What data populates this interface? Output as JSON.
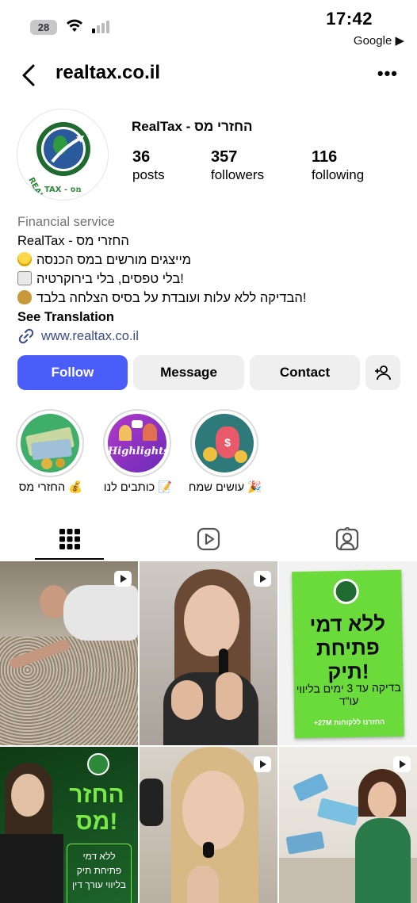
{
  "status_bar": {
    "battery": "28",
    "time": "17:42",
    "back_app": "Google ▶"
  },
  "header": {
    "username": "realtax.co.il",
    "more": "•••"
  },
  "profile": {
    "display_name": "RealTax - החזרי מס",
    "stats": [
      {
        "value": "36",
        "label": "posts"
      },
      {
        "value": "357",
        "label": "followers"
      },
      {
        "value": "116",
        "label": "following"
      }
    ],
    "category": "Financial service",
    "bio_lines": [
      "RealTax - החזרי מס",
      "מייצגים מורשים במס הכנסה",
      "בלי טפסים, בלי בירוקרטיה!",
      "הבדיקה ללא עלות ועובדת על בסיס הצלחה בלבד!"
    ],
    "see_translation": "See Translation",
    "link": "www.realtax.co.il",
    "logo_text": "REALTAX - החזרי מס"
  },
  "buttons": {
    "follow": "Follow",
    "message": "Message",
    "contact": "Contact"
  },
  "highlights": [
    {
      "label": "החזרי מס 💰",
      "icon": "cash-icon"
    },
    {
      "label": "כותבים לנו 📝",
      "icon": "highlights-icon",
      "image_text": "Highlights"
    },
    {
      "label": "עושים שמח 🎉",
      "icon": "money-bag-icon"
    }
  ],
  "tabs": [
    "grid-icon",
    "reels-icon",
    "tagged-icon"
  ],
  "posts": {
    "p3": {
      "title": "ללא דמי פתיחת תיק!",
      "sub": "בדיקה עד 3 ימים בליווי עו\"ד",
      "foot": "+27M החזרנו ללקוחות"
    },
    "p4": {
      "title": "החזר מס!",
      "sub1": "ללא דמי",
      "sub2": "פתיחת תיק",
      "sub3": "בליווי עורך דין"
    }
  },
  "colors": {
    "follow": "#4a5df9",
    "link": "#3a4a8c",
    "green": "#6adb3a"
  }
}
